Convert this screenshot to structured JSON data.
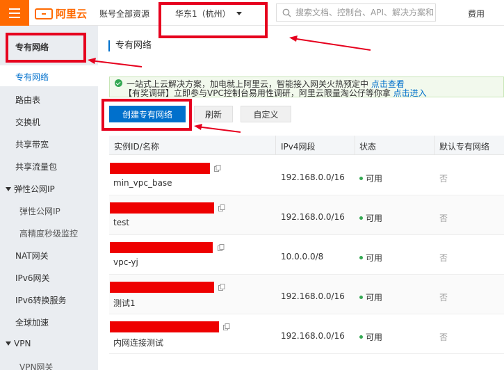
{
  "topbar": {
    "logo_text": "阿里云",
    "account_resources": "账号全部资源",
    "region": "华东1（杭州）",
    "search_placeholder": "搜索文档、控制台、API、解决方案和",
    "fee": "费用"
  },
  "sidebar": {
    "title": "专有网络",
    "items": [
      {
        "label": "专有网络",
        "active": true
      },
      {
        "label": "路由表"
      },
      {
        "label": "交换机"
      },
      {
        "label": "共享带宽"
      },
      {
        "label": "共享流量包"
      }
    ],
    "group_eip": "弹性公网IP",
    "eip_subitems": [
      "弹性公网IP",
      "高精度秒级监控"
    ],
    "items2": [
      "NAT网关",
      "IPv6网关",
      "IPv6转换服务",
      "全球加速"
    ],
    "group_vpn": "VPN",
    "vpn_subitems": [
      "VPN网关"
    ]
  },
  "main": {
    "page_title": "专有网络",
    "notice": {
      "line1": "一站式上云解决方案，加电就上阿里云，智能接入网关火热预定中",
      "line1_link": "点击查看",
      "line2": "【有奖调研】立即参与VPC控制台易用性调研，阿里云限量淘公仔等你拿",
      "line2_link": "点击进入"
    },
    "buttons": {
      "create": "创建专有网络",
      "refresh": "刷新",
      "customize": "自定义"
    },
    "table": {
      "headers": [
        "实例ID/名称",
        "IPv4网段",
        "状态",
        "默认专有网络"
      ],
      "rows": [
        {
          "name": "min_vpc_base",
          "cidr": "192.168.0.0/16",
          "status": "可用",
          "default": "否"
        },
        {
          "name": "test",
          "cidr": "192.168.0.0/16",
          "status": "可用",
          "default": "否"
        },
        {
          "name": "vpc-yj",
          "cidr": "10.0.0.0/8",
          "status": "可用",
          "default": "否"
        },
        {
          "name": "测试1",
          "cidr": "192.168.0.0/16",
          "status": "可用",
          "default": "否"
        },
        {
          "name": "内网连接测试",
          "cidr": "192.168.0.0/16",
          "status": "可用",
          "default": "否"
        }
      ]
    }
  },
  "colors": {
    "brand": "#ff6a00",
    "primary": "#0070cc",
    "annotation": "#e6001e",
    "status_ok": "#34a853"
  }
}
